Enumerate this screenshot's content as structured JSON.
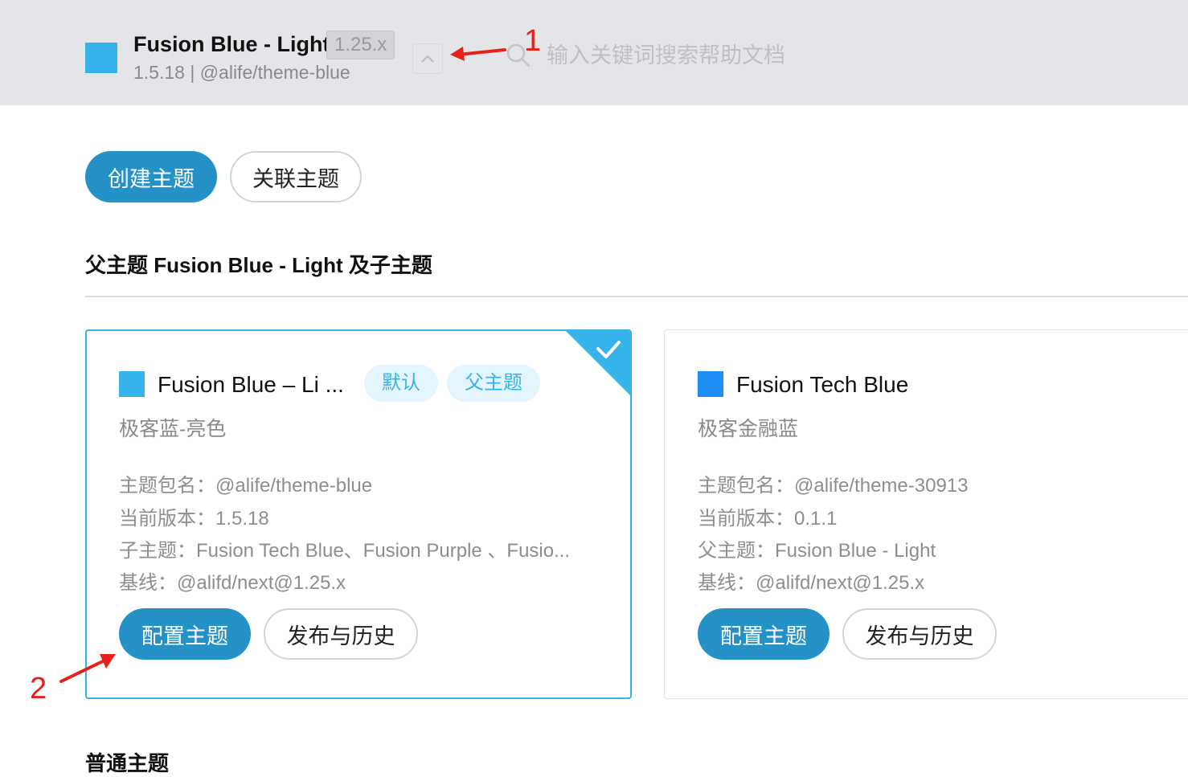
{
  "header": {
    "title": "Fusion Blue - Light",
    "version_tag": "1.25.x",
    "subtitle": "1.5.18 | @alife/theme-blue",
    "search_placeholder": "输入关键词搜索帮助文档"
  },
  "actions": {
    "create": "创建主题",
    "link": "关联主题"
  },
  "section": {
    "title": "父主题 Fusion Blue - Light 及子主题"
  },
  "cards": [
    {
      "name": "Fusion Blue – Li ...",
      "tags": [
        "默认",
        "父主题"
      ],
      "desc": "极客蓝-亮色",
      "package": "主题包名：@alife/theme-blue",
      "version": "当前版本：1.5.18",
      "relation": "子主题：Fusion Tech Blue、Fusion Purple 、Fusio...",
      "baseline": "基线：@alifd/next@1.25.x",
      "configure": "配置主题",
      "publish": "发布与历史",
      "color": "#35b3ea"
    },
    {
      "name": "Fusion Tech Blue",
      "desc": "极客金融蓝",
      "package": "主题包名：@alife/theme-30913",
      "version": "当前版本：0.1.1",
      "relation": "父主题：Fusion Blue - Light",
      "baseline": "基线：@alifd/next@1.25.x",
      "configure": "配置主题",
      "publish": "发布与历史",
      "color": "#1e8ef5"
    }
  ],
  "annotations": {
    "one": "1",
    "two": "2"
  },
  "bottom_section": {
    "title": "普通主题"
  },
  "colors": {
    "primary": "#2592c7",
    "accent": "#35b3ea",
    "annotation": "#e8201c"
  }
}
